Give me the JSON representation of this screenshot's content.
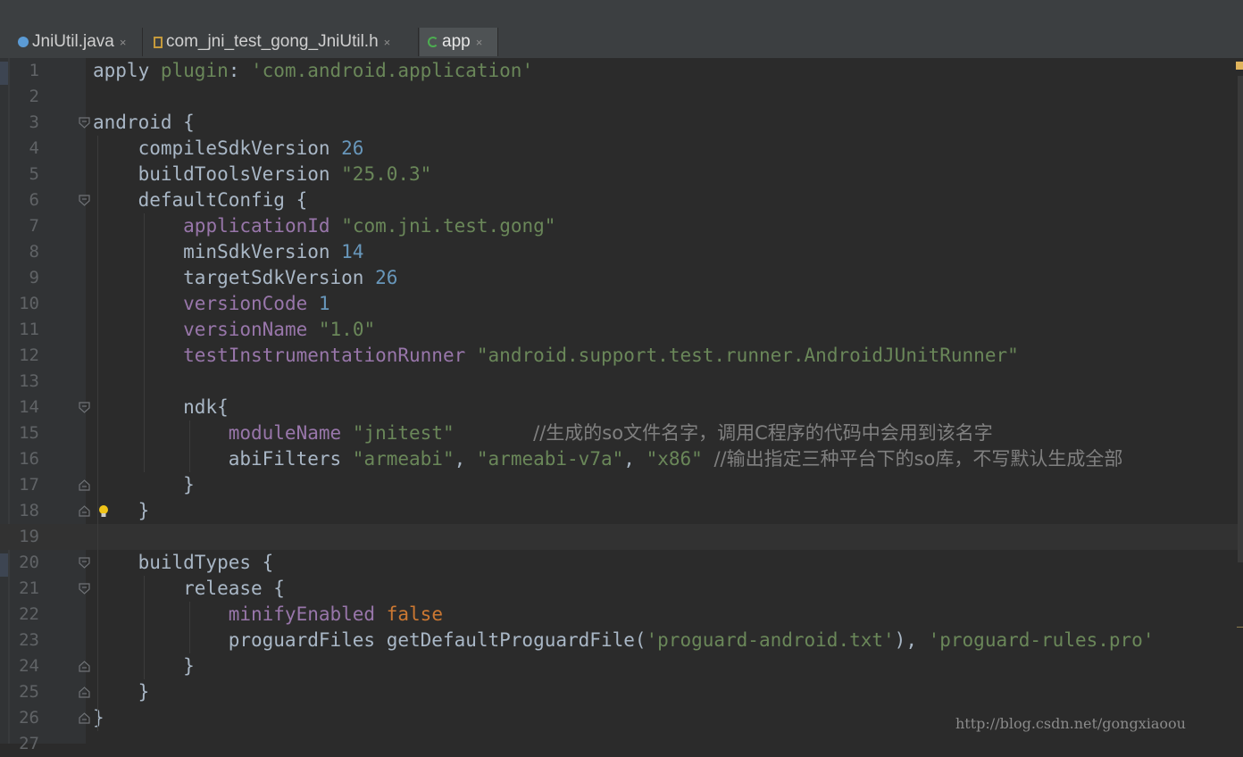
{
  "tabs": [
    {
      "label": "JniUtil.java",
      "icon": "java-class-icon",
      "active": false
    },
    {
      "label": "com_jni_test_gong_JniUtil.h",
      "icon": "header-file-icon",
      "active": false
    },
    {
      "label": "app",
      "icon": "gradle-icon",
      "active": true
    }
  ],
  "tab_close_glyph": "×",
  "lines": [
    {
      "n": "1",
      "tokens": [
        [
          "apply ",
          "plain"
        ],
        [
          "plugin",
          "str"
        ],
        [
          ": ",
          "plain"
        ],
        [
          "'com.android.application'",
          "str"
        ]
      ]
    },
    {
      "n": "2",
      "tokens": []
    },
    {
      "n": "3",
      "tokens": [
        [
          "android {",
          "plain"
        ]
      ]
    },
    {
      "n": "4",
      "tokens": [
        [
          "    compileSdkVersion ",
          "plain"
        ],
        [
          "26",
          "num"
        ]
      ]
    },
    {
      "n": "5",
      "tokens": [
        [
          "    buildToolsVersion ",
          "plain"
        ],
        [
          "\"25.0.3\"",
          "str"
        ]
      ]
    },
    {
      "n": "6",
      "tokens": [
        [
          "    defaultConfig {",
          "plain"
        ]
      ]
    },
    {
      "n": "7",
      "tokens": [
        [
          "        ",
          "plain"
        ],
        [
          "applicationId",
          "prop"
        ],
        [
          " ",
          "plain"
        ],
        [
          "\"com.jni.test.gong\"",
          "str"
        ]
      ]
    },
    {
      "n": "8",
      "tokens": [
        [
          "        minSdkVersion ",
          "plain"
        ],
        [
          "14",
          "num"
        ]
      ]
    },
    {
      "n": "9",
      "tokens": [
        [
          "        targetSdkVersion ",
          "plain"
        ],
        [
          "26",
          "num"
        ]
      ]
    },
    {
      "n": "10",
      "tokens": [
        [
          "        ",
          "plain"
        ],
        [
          "versionCode",
          "prop"
        ],
        [
          " ",
          "plain"
        ],
        [
          "1",
          "num"
        ]
      ]
    },
    {
      "n": "11",
      "tokens": [
        [
          "        ",
          "plain"
        ],
        [
          "versionName",
          "prop"
        ],
        [
          " ",
          "plain"
        ],
        [
          "\"1.0\"",
          "str"
        ]
      ]
    },
    {
      "n": "12",
      "tokens": [
        [
          "        ",
          "plain"
        ],
        [
          "testInstrumentationRunner",
          "prop"
        ],
        [
          " ",
          "plain"
        ],
        [
          "\"android.support.test.runner.AndroidJUnitRunner\"",
          "str"
        ]
      ]
    },
    {
      "n": "13",
      "tokens": []
    },
    {
      "n": "14",
      "tokens": [
        [
          "        ndk{",
          "plain"
        ]
      ]
    },
    {
      "n": "15",
      "tokens": [
        [
          "            ",
          "plain"
        ],
        [
          "moduleName",
          "prop"
        ],
        [
          " ",
          "plain"
        ],
        [
          "\"jnitest\"",
          "str"
        ],
        [
          "       ",
          "plain"
        ],
        [
          "//生成的so文件名字，调用C程序的代码中会用到该名字",
          "cmt"
        ]
      ]
    },
    {
      "n": "16",
      "tokens": [
        [
          "            abiFilters ",
          "plain"
        ],
        [
          "\"armeabi\"",
          "str"
        ],
        [
          ", ",
          "plain"
        ],
        [
          "\"armeabi-v7a\"",
          "str"
        ],
        [
          ", ",
          "plain"
        ],
        [
          "\"x86\"",
          "str"
        ],
        [
          " ",
          "plain"
        ],
        [
          "//输出指定三种平台下的so库，不写默认生成全部",
          "cmt"
        ]
      ]
    },
    {
      "n": "17",
      "tokens": [
        [
          "        }",
          "plain"
        ]
      ]
    },
    {
      "n": "18",
      "tokens": [
        [
          "    }",
          "plain"
        ]
      ]
    },
    {
      "n": "19",
      "tokens": []
    },
    {
      "n": "20",
      "tokens": [
        [
          "    buildTypes {",
          "plain"
        ]
      ]
    },
    {
      "n": "21",
      "tokens": [
        [
          "        release {",
          "plain"
        ]
      ]
    },
    {
      "n": "22",
      "tokens": [
        [
          "            ",
          "plain"
        ],
        [
          "minifyEnabled",
          "prop"
        ],
        [
          " ",
          "plain"
        ],
        [
          "false",
          "kw"
        ]
      ]
    },
    {
      "n": "23",
      "tokens": [
        [
          "            proguardFiles getDefaultProguardFile(",
          "plain"
        ],
        [
          "'proguard-android.txt'",
          "str"
        ],
        [
          "), ",
          "plain"
        ],
        [
          "'proguard-rules.pro'",
          "str"
        ]
      ]
    },
    {
      "n": "24",
      "tokens": [
        [
          "        }",
          "plain"
        ]
      ]
    },
    {
      "n": "25",
      "tokens": [
        [
          "    }",
          "plain"
        ]
      ]
    },
    {
      "n": "26",
      "tokens": [
        [
          "}",
          "plain"
        ]
      ]
    },
    {
      "n": "27",
      "tokens": []
    }
  ],
  "fold_open_lines": [
    "3",
    "6",
    "14",
    "20",
    "21"
  ],
  "fold_close_lines": [
    "17",
    "18",
    "24",
    "25",
    "26"
  ],
  "caret_line": "19",
  "bulb_line": "18",
  "watermark": "http://blog.csdn.net/gongxiaoou"
}
